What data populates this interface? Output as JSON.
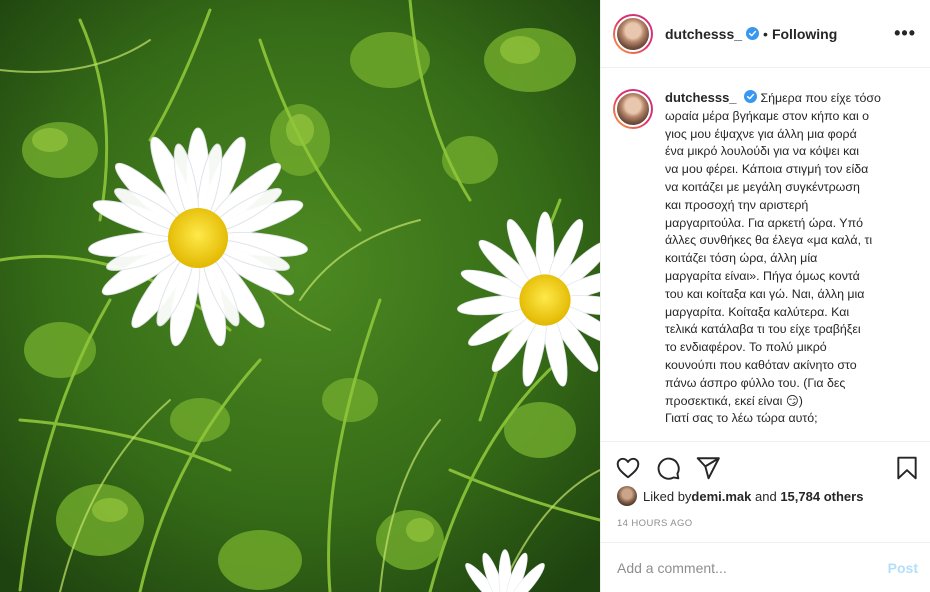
{
  "post": {
    "username": "dutchesss_",
    "follow_status": "Following",
    "separator": "•",
    "more_label": "•••",
    "caption_lines": [
      "Σήμερα που είχε τόσο",
      "ωραία μέρα βγήκαμε στον κήπο και ο",
      "γιος μου έψαχνε για άλλη μια φορά",
      "ένα μικρό λουλούδι για να κόψει και",
      "να μου φέρει. Κάποια στιγμή τον είδα",
      "να κοιτάζει με μεγάλη συγκέντρωση",
      "και προσοχή την αριστερή",
      "μαργαριτούλα. Για αρκετή ώρα. Υπό",
      "άλλες συνθήκες θα έλεγα «μα καλά, τι",
      "κοιτάζει τόση ώρα, άλλη μία",
      "μαργαρίτα είναι». Πήγα όμως κοντά",
      "του και κοίταξα και γώ. Ναι, άλλη μια",
      "μαργαρίτα. Κοίταξα καλύτερα. Και",
      "τελικά κατάλαβα τι του είχε τραβήξει",
      "το ενδιαφέρον. Το πολύ μικρό",
      "κουνούπι που καθόταν ακίνητο στο",
      "πάνω άσπρο φύλλο του. (Για δες",
      "προσεκτικά, εκεί είναι 😏)",
      "Γιατί σας το λέω τώρα αυτό;"
    ],
    "likes_prefix": "Liked by ",
    "liked_by_user": "demi.mak",
    "likes_and": " and ",
    "likes_count": "15,784 others",
    "time_ago": "14 HOURS AGO",
    "comment_placeholder": "Add a comment...",
    "post_button": "Post"
  },
  "icons": {
    "like": "heart-icon",
    "comment": "comment-icon",
    "share": "send-icon",
    "save": "bookmark-icon",
    "verified": "verified-badge-icon"
  },
  "colors": {
    "verified_blue": "#3897f0",
    "post_button_disabled": "#b2dffc",
    "secondary_text": "#8e8e8e",
    "border": "#efefef"
  }
}
